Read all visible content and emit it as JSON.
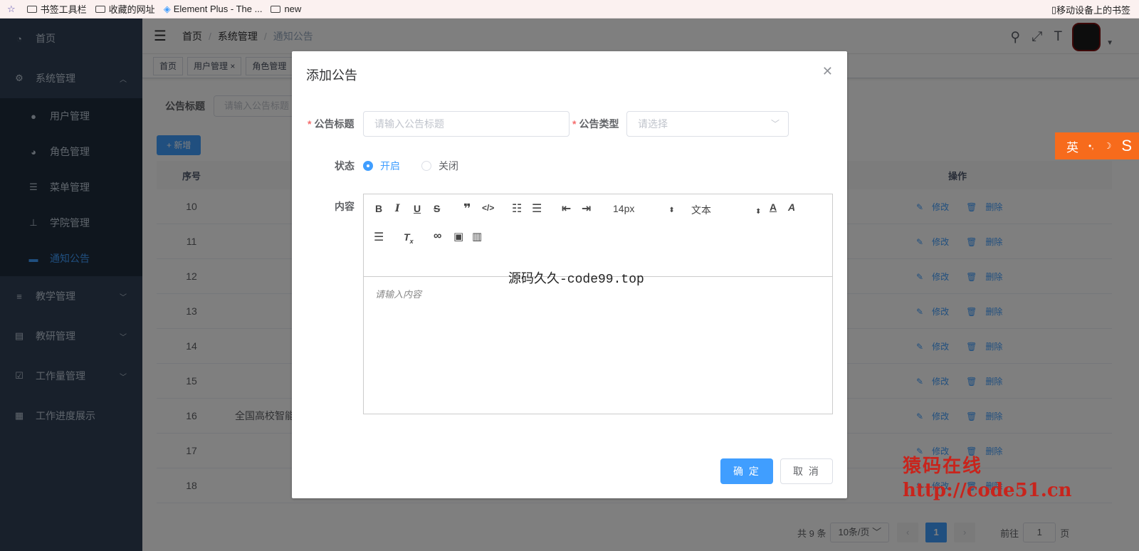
{
  "bookmarks": {
    "items": [
      "书签工具栏",
      "收藏的网址",
      "Element Plus - The ...",
      "new"
    ],
    "right": "移动设备上的书签"
  },
  "sidebar": {
    "home": "首页",
    "system": "系统管理",
    "sub": [
      "用户管理",
      "角色管理",
      "菜单管理",
      "学院管理",
      "通知公告"
    ],
    "rest": [
      "教学管理",
      "教研管理",
      "工作量管理",
      "工作进度展示"
    ]
  },
  "navbar": {
    "breadcrumb": [
      "首页",
      "系统管理",
      "通知公告"
    ]
  },
  "tags": [
    "首页",
    "用户管理",
    "角色管理"
  ],
  "search": {
    "label": "公告标题",
    "placeholder": "请输入公告标题"
  },
  "add_button": "+ 新增",
  "table": {
    "col_index": "序号",
    "col_ops": "操作",
    "rows": [
      {
        "idx": "10",
        "title": ""
      },
      {
        "idx": "11",
        "title": ""
      },
      {
        "idx": "12",
        "title": ""
      },
      {
        "idx": "13",
        "title": ""
      },
      {
        "idx": "14",
        "title": ""
      },
      {
        "idx": "15",
        "title": ""
      },
      {
        "idx": "16",
        "title": "全国高校智能"
      },
      {
        "idx": "17",
        "title": ""
      },
      {
        "idx": "18",
        "title": ""
      }
    ],
    "edit": "修改",
    "delete": "删除"
  },
  "pagination": {
    "total": "共 9 条",
    "page_size": "10条/页",
    "current": "1",
    "goto_prefix": "前往",
    "goto_value": "1",
    "goto_suffix": "页"
  },
  "dialog": {
    "title": "添加公告",
    "title_label": "公告标题",
    "title_placeholder": "请输入公告标题",
    "type_label": "公告类型",
    "type_placeholder": "请选择",
    "status_label": "状态",
    "status_on": "开启",
    "status_off": "关闭",
    "content_label": "内容",
    "font_size": "14px",
    "text_style": "文本",
    "content_placeholder": "请输入内容",
    "confirm": "确 定",
    "cancel": "取 消"
  },
  "watermarks": {
    "top": "源码久久-code99.top",
    "line1": "猿码在线",
    "line2": "http://code51.cn"
  },
  "ime": {
    "label": "英"
  },
  "colors": {
    "primary": "#409eff",
    "sidebar": "#304156",
    "watermark": "#c8241c",
    "ime": "#f76b1c"
  }
}
